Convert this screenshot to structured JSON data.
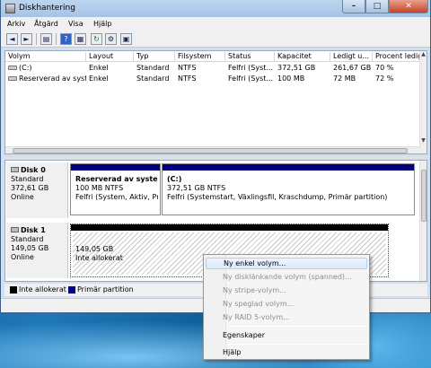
{
  "window": {
    "title": "Diskhantering",
    "controls": {
      "minimize": "–",
      "maximize": "□",
      "close": "✕"
    }
  },
  "menubar": {
    "items": [
      "Arkiv",
      "Åtgärd",
      "Visa",
      "Hjälp"
    ]
  },
  "toolbar": {
    "buttons": [
      "back-icon",
      "forward-icon",
      "console-tree-icon",
      "help-icon",
      "properties-icon",
      "refresh-icon",
      "settings-icon",
      "console-icon"
    ]
  },
  "volume_list": {
    "columns": [
      "Volym",
      "Layout",
      "Typ",
      "Filsystem",
      "Status",
      "Kapacitet",
      "Ledigt u...",
      "Procent ledig..."
    ],
    "rows": [
      [
        "(C:)",
        "Enkel",
        "Standard",
        "NTFS",
        "Felfri (Syst...",
        "372,51 GB",
        "261,67 GB",
        "70 %"
      ],
      [
        "Reserverad av syst...",
        "Enkel",
        "Standard",
        "NTFS",
        "Felfri (Syst...",
        "100 MB",
        "72 MB",
        "72 %"
      ]
    ]
  },
  "disks": [
    {
      "name": "Disk 0",
      "type": "Standard",
      "size": "372,61 GB",
      "status": "Online",
      "partitions": [
        {
          "title": "Reserverad av systemet",
          "size": "100 MB NTFS",
          "status": "Felfri (System, Aktiv, Prim"
        },
        {
          "title": "(C:)",
          "size": "372,51 GB NTFS",
          "status": "Felfri (Systemstart, Växlingsfil, Kraschdump, Primär partition)"
        }
      ]
    },
    {
      "name": "Disk 1",
      "type": "Standard",
      "size": "149,05 GB",
      "status": "Online",
      "partitions": [
        {
          "size": "149,05 GB",
          "status": "Inte allokerat"
        }
      ]
    }
  ],
  "legend": {
    "items": [
      {
        "label": "Inte allokerat",
        "color": "#000000"
      },
      {
        "label": "Primär partition",
        "color": "#000080"
      }
    ]
  },
  "context_menu": {
    "items": [
      {
        "label": "Ny enkel volym...",
        "enabled": true,
        "highlighted": true
      },
      {
        "label": "Ny disklänkande volym (spanned)...",
        "enabled": false
      },
      {
        "label": "Ny stripe-volym...",
        "enabled": false
      },
      {
        "label": "Ny speglad volym...",
        "enabled": false
      },
      {
        "label": "Ny RAID 5-volym...",
        "enabled": false
      },
      {
        "label": "Egenskaper",
        "enabled": true
      },
      {
        "label": "Hjälp",
        "enabled": true
      }
    ]
  },
  "colors": {
    "primary_partition": "#000080",
    "unallocated": "#000000",
    "titlebar": "#a4c3e6"
  }
}
